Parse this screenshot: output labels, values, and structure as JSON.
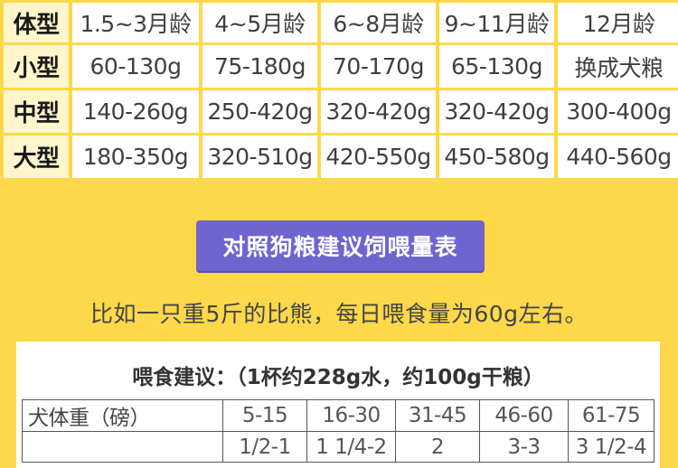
{
  "size_table": {
    "header": [
      "体型",
      "1.5~3月龄",
      "4~5月龄",
      "6~8月龄",
      "9~11月龄",
      "12月龄"
    ],
    "rows": [
      {
        "type": "小型",
        "cells": [
          "60-130g",
          "75-180g",
          "70-170g",
          "65-130g",
          "换成犬粮"
        ]
      },
      {
        "type": "中型",
        "cells": [
          "140-260g",
          "250-420g",
          "320-420g",
          "320-420g",
          "300-400g"
        ]
      },
      {
        "type": "大型",
        "cells": [
          "180-350g",
          "320-510g",
          "420-550g",
          "450-580g",
          "440-560g"
        ]
      }
    ]
  },
  "button": {
    "label": "对照狗粮建议饲喂量表"
  },
  "example": {
    "text": "比如一只重5斤的比熊，每日喂食量为60g左右。"
  },
  "feeding": {
    "title": "喂食建议：（1杯约228g水，约100g干粮）",
    "row_weight_label": "犬体重（磅）",
    "weights": [
      "5-15",
      "16-30",
      "31-45",
      "46-60",
      "61-75"
    ],
    "cups": [
      "1/2-1",
      "1 1/4-2",
      "2",
      "3-3",
      "3 1/2-4"
    ]
  },
  "colors": {
    "background": "#fdd84a",
    "header_cell": "#fff6cc",
    "button": "#6f65cf"
  }
}
